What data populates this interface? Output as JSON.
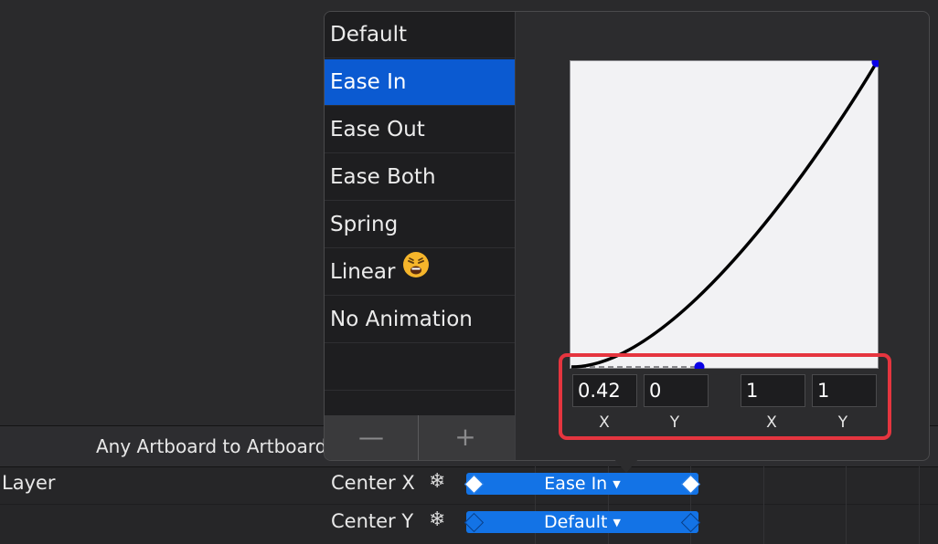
{
  "transition": {
    "label": "Any Artboard to Artboard"
  },
  "layer": {
    "label": "Layer"
  },
  "properties": [
    {
      "name": "Center X",
      "curve": "Ease In"
    },
    {
      "name": "Center Y",
      "curve": "Default"
    }
  ],
  "presets": {
    "items": [
      "Default",
      "Ease In",
      "Ease Out",
      "Ease Both",
      "Spring",
      "Linear",
      "No Animation"
    ],
    "selected": "Ease In",
    "linear_emoji": "😩",
    "remove_label": "—",
    "add_label": "+"
  },
  "bezier": {
    "p1": {
      "x": "0.42",
      "y": "0"
    },
    "p2": {
      "x": "1",
      "y": "1"
    },
    "labels": {
      "x": "X",
      "y": "Y"
    }
  },
  "colors": {
    "accent": "#1373e6",
    "selection": "#0b5ad1",
    "highlight": "#e5353f",
    "control_point": "#0a00e6"
  }
}
